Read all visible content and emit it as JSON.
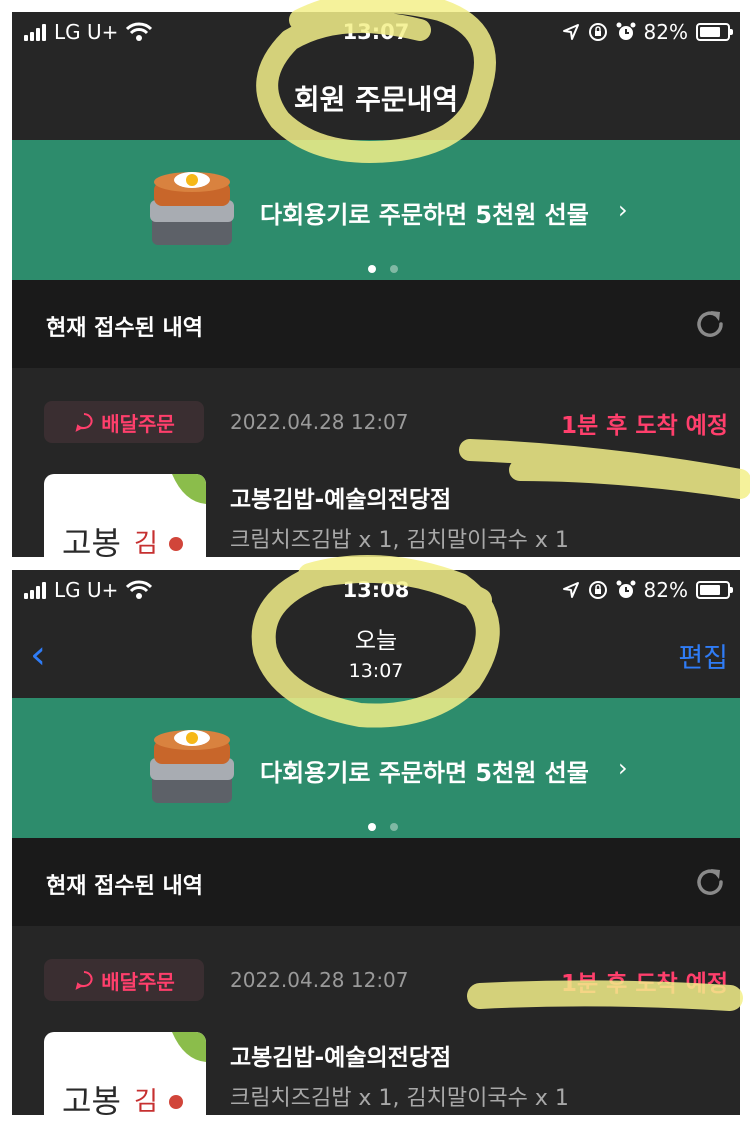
{
  "top": {
    "status": {
      "carrier": "LG U+",
      "time": "13:07",
      "battery": "82%"
    },
    "nav": {
      "title": "회원 주문내역"
    },
    "banner": {
      "text": "다회용기로 주문하면 5천원 선물",
      "chevron": "›"
    },
    "section": {
      "title": "현재 접수된 내역"
    },
    "order": {
      "badge": "배달주문",
      "date": "2022.04.28 12:07",
      "eta": "1분 후 도착 예정",
      "store": "고봉김밥-예술의전당점",
      "items": "크림치즈김밥 x 1, 김치말이국수 x 1"
    }
  },
  "bottom": {
    "status": {
      "carrier": "LG U+",
      "time": "13:08",
      "battery": "82%"
    },
    "nav": {
      "title": "오늘",
      "subtitle": "13:07",
      "back": "‹",
      "edit": "편집"
    },
    "banner": {
      "text": "다회용기로 주문하면 5천원 선물",
      "chevron": "›"
    },
    "section": {
      "title": "현재 접수된 내역"
    },
    "order": {
      "badge": "배달주문",
      "date": "2022.04.28 12:07",
      "eta": "1분 후 도착 예정",
      "store": "고봉김밥-예술의전당점",
      "items": "크림치즈김밥 x 1, 김치말이국수 x 1"
    }
  },
  "colors": {
    "accent": "#ff3f6c",
    "banner": "#2d8c6c",
    "link": "#2f7cf6",
    "highlighter": "#f3f08a"
  },
  "icons": [
    "signal-icon",
    "wifi-icon",
    "location-icon",
    "lock-rotation-icon",
    "alarm-icon",
    "battery-icon",
    "refresh-icon",
    "chat-bubble-icon",
    "food-container-icon",
    "store-logo"
  ]
}
